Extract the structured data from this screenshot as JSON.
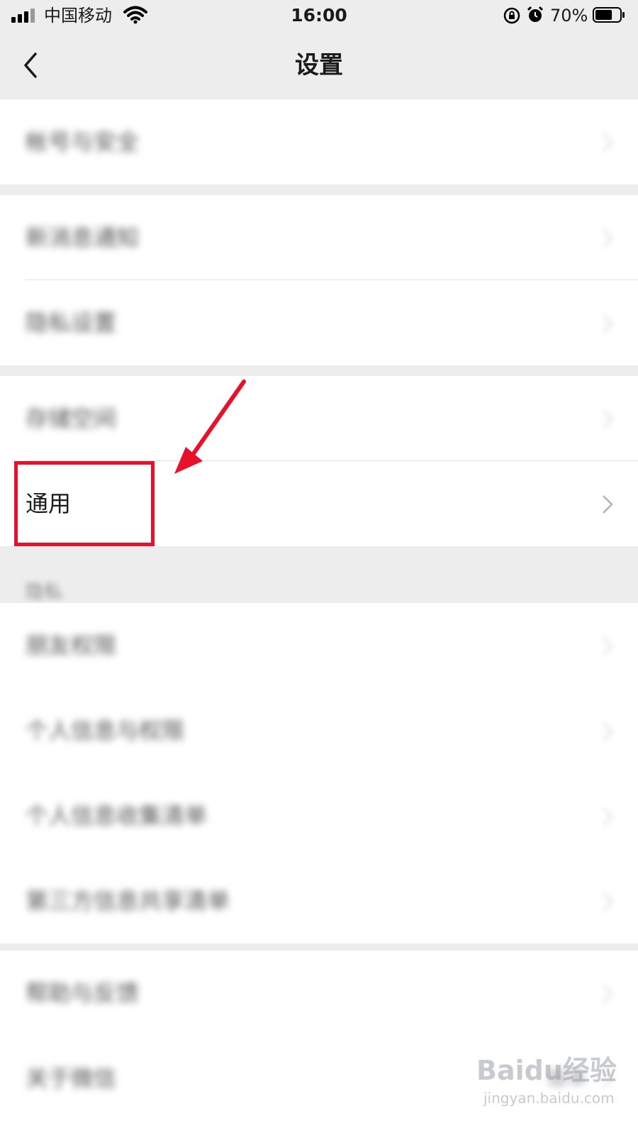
{
  "status_bar": {
    "carrier": "中国移动",
    "time": "16:00",
    "battery": "70%",
    "battery_level": 0.7,
    "icons": [
      "signal-icon",
      "wifi-icon",
      "rotation-lock-icon",
      "alarm-icon",
      "battery-icon"
    ]
  },
  "nav": {
    "title": "设置",
    "back_icon": "chevron-left-icon"
  },
  "groups": [
    {
      "items": [
        {
          "label": "帐号与安全"
        }
      ]
    },
    {
      "items": [
        {
          "label": "新消息通知"
        },
        {
          "label": "隐私设置"
        }
      ]
    },
    {
      "items": [
        {
          "label": "存储空间"
        },
        {
          "label": "通用"
        }
      ]
    }
  ],
  "section_header": "隐私",
  "groups_after_header": [
    {
      "items": [
        {
          "label": "朋友权限"
        },
        {
          "label": "个人信息与权限"
        },
        {
          "label": "个人信息收集清单"
        },
        {
          "label": "第三方信息共享清单"
        }
      ]
    },
    {
      "items": [
        {
          "label": "帮助与反馈"
        },
        {
          "label": "关于微信",
          "value": "版本"
        }
      ]
    }
  ],
  "annotation": {
    "highlight_color": "#e8102a",
    "highlighted_item": "通用"
  },
  "watermark": {
    "brand": "Baidu经验",
    "url": "jingyan.baidu.com"
  }
}
